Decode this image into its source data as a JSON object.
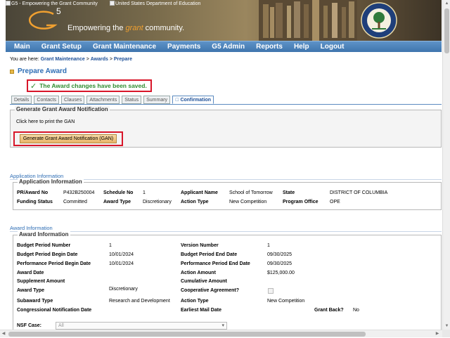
{
  "header": {
    "alt_g5": "G5 - Empowering the Grant Community",
    "alt_ed": "United States Department of Education",
    "logo_text": "G5",
    "tagline_pre": "Empowering the ",
    "tagline_grant": "grant",
    "tagline_post": " community."
  },
  "nav": {
    "items": [
      "Main",
      "Grant Setup",
      "Grant Maintenance",
      "Payments",
      "G5 Admin",
      "Reports",
      "Help",
      "Logout"
    ]
  },
  "breadcrumb": {
    "prefix": "You are here: ",
    "items": [
      "Grant Maintenance",
      "Awards",
      "Prepare"
    ],
    "sep": " > "
  },
  "page": {
    "title": "Prepare Award",
    "success_message": "The Award changes have been saved.",
    "success_icon": "check-icon"
  },
  "tabs": [
    {
      "label": "Details"
    },
    {
      "label": "Contacts"
    },
    {
      "label": "Clauses"
    },
    {
      "label": "Attachments"
    },
    {
      "label": "Status"
    },
    {
      "label": "Summary"
    },
    {
      "label": "Confirmation",
      "active": true
    }
  ],
  "gan": {
    "legend": "Generate Grant Award Notification",
    "print_text": "Click here to print the GAN",
    "button_label": "Generate Grant Award Notification (GAN)"
  },
  "application": {
    "section_title": "Application Information",
    "legend": "Application Information",
    "fields": {
      "pr_award_no_label": "PR/Award No",
      "pr_award_no": "P432B250004",
      "schedule_no_label": "Schedule No",
      "schedule_no": "1",
      "applicant_name_label": "Applicant Name",
      "applicant_name": "School of Tomorrow",
      "state_label": "State",
      "state": "DISTRICT OF COLUMBIA",
      "funding_status_label": "Funding Status",
      "funding_status": "Committed",
      "award_type_label": "Award Type",
      "award_type": "Discretionary",
      "action_type_label": "Action Type",
      "action_type": "New Competition",
      "program_office_label": "Program Office",
      "program_office": "OPE"
    }
  },
  "award": {
    "section_title": "Award Information",
    "legend": "Award Information",
    "fields": {
      "budget_period_number_label": "Budget Period Number",
      "budget_period_number": "1",
      "version_number_label": "Version Number",
      "version_number": "1",
      "bp_begin_label": "Budget Period Begin Date",
      "bp_begin": "10/01/2024",
      "bp_end_label": "Budget Period End Date",
      "bp_end": "09/30/2025",
      "pp_begin_label": "Performance Period Begin Date",
      "pp_begin": "10/01/2024",
      "pp_end_label": "Performance Period End Date",
      "pp_end": "09/30/2025",
      "award_date_label": "Award Date",
      "award_date": "",
      "action_amount_label": "Action Amount",
      "action_amount": "$125,000.00",
      "supplement_amount_label": "Supplement Amount",
      "supplement_amount": "",
      "cumulative_amount_label": "Cumulative Amount",
      "cumulative_amount": "",
      "award_type_label": "Award Type",
      "award_type": "Discretionary",
      "coop_label": "Cooperative Agreement?",
      "subaward_type_label": "Subaward Type",
      "subaward_type": "Research and Development",
      "action_type_label": "Action Type",
      "action_type": "New Competition",
      "cong_date_label": "Congressional Notification Date",
      "cong_date": "",
      "mail_date_label": "Earliest Mail Date",
      "mail_date": "",
      "grant_back_label": "Grant Back?",
      "grant_back": "No",
      "nsf_case_label": "NSF Case:",
      "nsf_case_value": "All"
    }
  },
  "colors": {
    "nav_blue": "#3f75ad",
    "title_blue": "#2d6db4",
    "success_green": "#2e8b2e",
    "highlight_red": "#d8162a",
    "button_orange": "#e9b467"
  }
}
